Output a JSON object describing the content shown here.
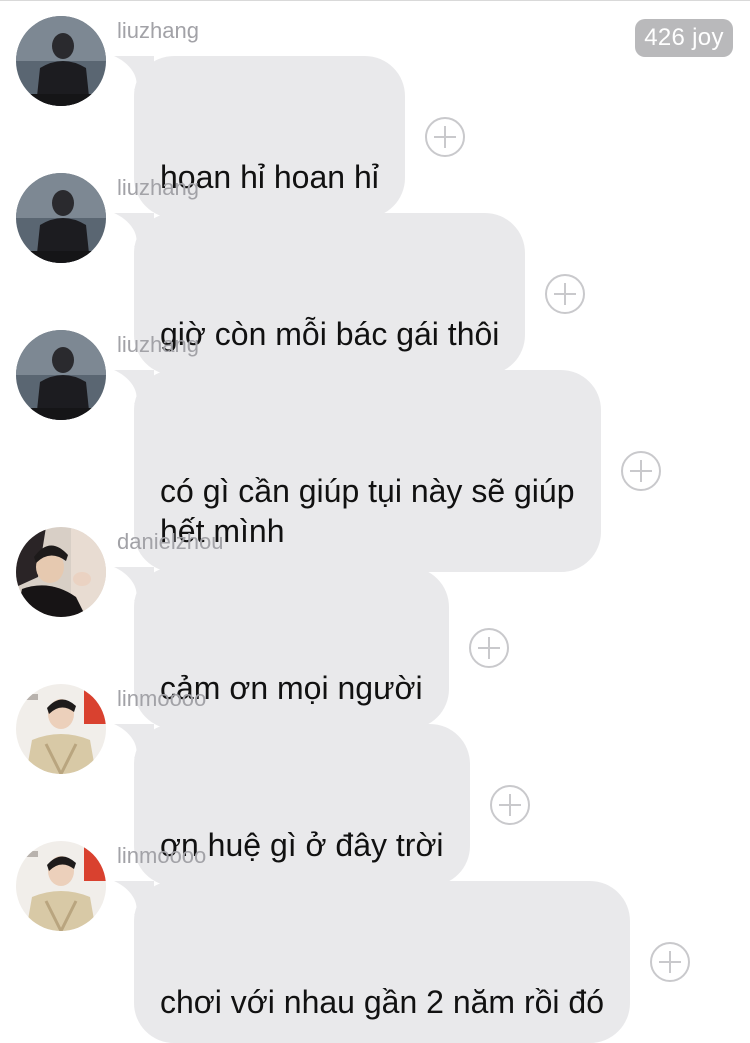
{
  "header": {
    "joy_count": "426 joy"
  },
  "messages": [
    {
      "username": "liuzhang",
      "text": "hoan hỉ hoan hỉ",
      "avatar": "avatar-liuzhang"
    },
    {
      "username": "liuzhang",
      "text": "giờ còn mỗi bác gái thôi",
      "avatar": "avatar-liuzhang"
    },
    {
      "username": "liuzhang",
      "text": "có gì cần giúp tụi này sẽ giúp\nhết mình",
      "avatar": "avatar-liuzhang"
    },
    {
      "username": "danielzhou",
      "text": "cảm ơn mọi người",
      "avatar": "avatar-danielzhou"
    },
    {
      "username": "linmoooo",
      "text": "ơn huệ gì ở đây trời",
      "avatar": "avatar-linmoooo"
    },
    {
      "username": "linmoooo",
      "text": "chơi với nhau gần 2 năm rồi đó",
      "avatar": "avatar-linmoooo"
    }
  ],
  "colors": {
    "bubble": "#e9e9eb",
    "username": "#a2a2a7",
    "badge": "#b9b9bb",
    "add_icon": "#c9c9cc"
  }
}
